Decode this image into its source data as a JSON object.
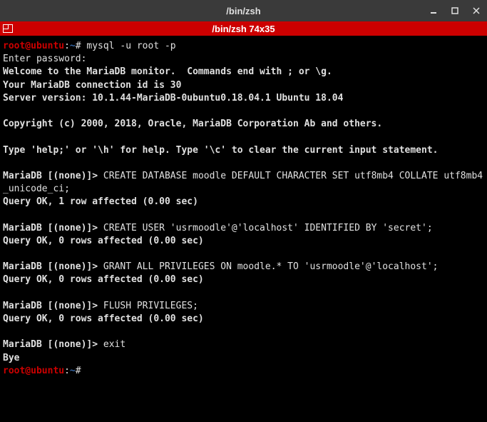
{
  "titlebar": {
    "title": "/bin/zsh"
  },
  "subheader": {
    "text": "/bin/zsh 74x35"
  },
  "prompt": {
    "user_host": "root@ubuntu",
    "separator": ":",
    "path": "~",
    "symbol": "# "
  },
  "mariadb_prompt": "MariaDB [(none)]> ",
  "session": {
    "cmd1": "mysql -u root -p",
    "line2": "Enter password:",
    "line3": "Welcome to the MariaDB monitor.  Commands end with ; or \\g.",
    "line4": "Your MariaDB connection id is 30",
    "line5": "Server version: 10.1.44-MariaDB-0ubuntu0.18.04.1 Ubuntu 18.04",
    "line6": "Copyright (c) 2000, 2018, Oracle, MariaDB Corporation Ab and others.",
    "line7": "Type 'help;' or '\\h' for help. Type '\\c' to clear the current input statement.",
    "sql1": "CREATE DATABASE moodle DEFAULT CHARACTER SET utf8mb4 COLLATE utf8mb4_unicode_ci;",
    "res1": "Query OK, 1 row affected (0.00 sec)",
    "sql2": "CREATE USER 'usrmoodle'@'localhost' IDENTIFIED BY 'secret';",
    "res2": "Query OK, 0 rows affected (0.00 sec)",
    "sql3": "GRANT ALL PRIVILEGES ON moodle.* TO 'usrmoodle'@'localhost';",
    "res3": "Query OK, 0 rows affected (0.00 sec)",
    "sql4": "FLUSH PRIVILEGES;",
    "res4": "Query OK, 0 rows affected (0.00 sec)",
    "sql5": "exit",
    "bye": "Bye"
  }
}
